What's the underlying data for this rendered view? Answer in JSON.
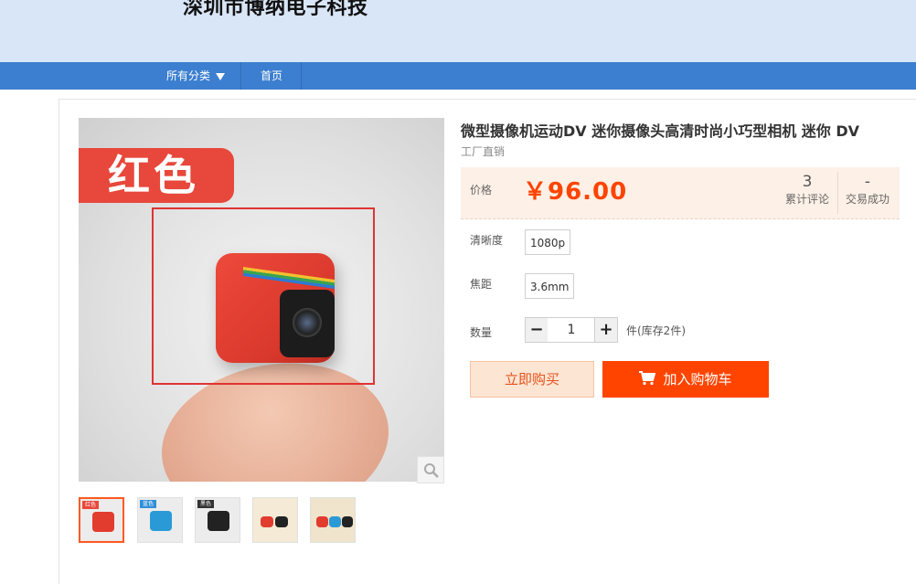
{
  "header": {
    "store_name": "深圳市博纳电子科技"
  },
  "nav": {
    "categories_label": "所有分类",
    "home_label": "首页"
  },
  "gallery": {
    "main_color_tag": "红色",
    "thumbnails": [
      {
        "tag": "红色",
        "active": true
      },
      {
        "tag": "蓝色",
        "active": false
      },
      {
        "tag": "黑色",
        "active": false
      },
      {
        "tag": "",
        "active": false
      },
      {
        "tag": "",
        "active": false
      }
    ]
  },
  "product": {
    "title": "微型摄像机运动DV 迷你摄像头高清时尚小巧型相机 迷你 DV",
    "subtitle": "工厂直销",
    "price_label": "价格",
    "price": "￥96.00",
    "reviews_count": "3",
    "reviews_label": "累计评论",
    "deals_count": "-",
    "deals_label": "交易成功",
    "options": [
      {
        "label": "清晰度",
        "value": "1080p"
      },
      {
        "label": "焦距",
        "value": "3.6mm"
      }
    ],
    "quantity_label": "数量",
    "quantity": "1",
    "stock_text": "件(库存2件)",
    "buy_now_label": "立即购买",
    "add_cart_label": "加入购物车"
  },
  "colors": {
    "accent": "#ff4400",
    "nav_bg": "#3c7fd0",
    "banner_bg": "#d9e6f7"
  }
}
